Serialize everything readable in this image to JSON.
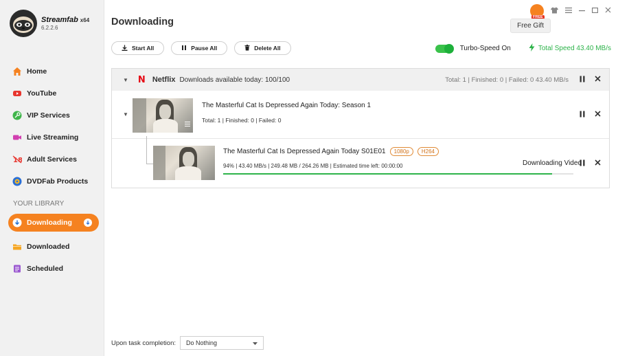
{
  "app": {
    "name": "Streamfab",
    "arch": "x64",
    "version": "6.2.2.6"
  },
  "nav": [
    {
      "label": "Home",
      "icon": "home-icon",
      "color": "#f58220"
    },
    {
      "label": "YouTube",
      "icon": "youtube-icon",
      "color": "#e8362f"
    },
    {
      "label": "VIP Services",
      "icon": "key-icon",
      "color": "#3fb54a"
    },
    {
      "label": "Live Streaming",
      "icon": "camera-icon",
      "color": "#d13fb0"
    },
    {
      "label": "Adult Services",
      "icon": "adult-18-icon",
      "color": "#e8362f"
    },
    {
      "label": "DVDFab Products",
      "icon": "dvdfab-icon",
      "color": "#2a6fd6"
    }
  ],
  "library": {
    "title": "YOUR LIBRARY",
    "items": [
      {
        "label": "Downloading",
        "icon": "download-icon",
        "active": true
      },
      {
        "label": "Downloaded",
        "icon": "folder-icon",
        "active": false
      },
      {
        "label": "Scheduled",
        "icon": "calendar-icon",
        "active": false
      }
    ]
  },
  "page": {
    "title": "Downloading"
  },
  "window": {
    "free_badge": "FREE",
    "free_gift": "Free Gift"
  },
  "toolbar": {
    "start_all": "Start All",
    "pause_all": "Pause All",
    "delete_all": "Delete All"
  },
  "turbo": {
    "label": "Turbo-Speed On",
    "enabled": true,
    "total_speed": "Total Speed 43.40 MB/s"
  },
  "service": {
    "logo": "N",
    "name": "Netflix",
    "availability": "Downloads available today: 100/100",
    "stats": "Total: 1  |  Finished: 0  |  Failed: 0    43.40 MB/s"
  },
  "season": {
    "title": "The Masterful Cat Is Depressed Again Today: Season 1",
    "stats": "Total: 1  |  Finished: 0  |  Failed: 0"
  },
  "episode": {
    "title": "The Masterful Cat Is Depressed Again Today S01E01",
    "resolution": "1080p",
    "codec": "H264",
    "stats": "94%  |  43.40 MB/s  |  249.48 MB / 264.26 MB  |  Estimated time left: 00:00:00",
    "status": "Downloading Video",
    "progress": 0.94
  },
  "footer": {
    "label": "Upon task completion:",
    "option": "Do Nothing"
  },
  "colors": {
    "accent": "#f58220",
    "success": "#2db34a",
    "netflix": "#e50914"
  }
}
